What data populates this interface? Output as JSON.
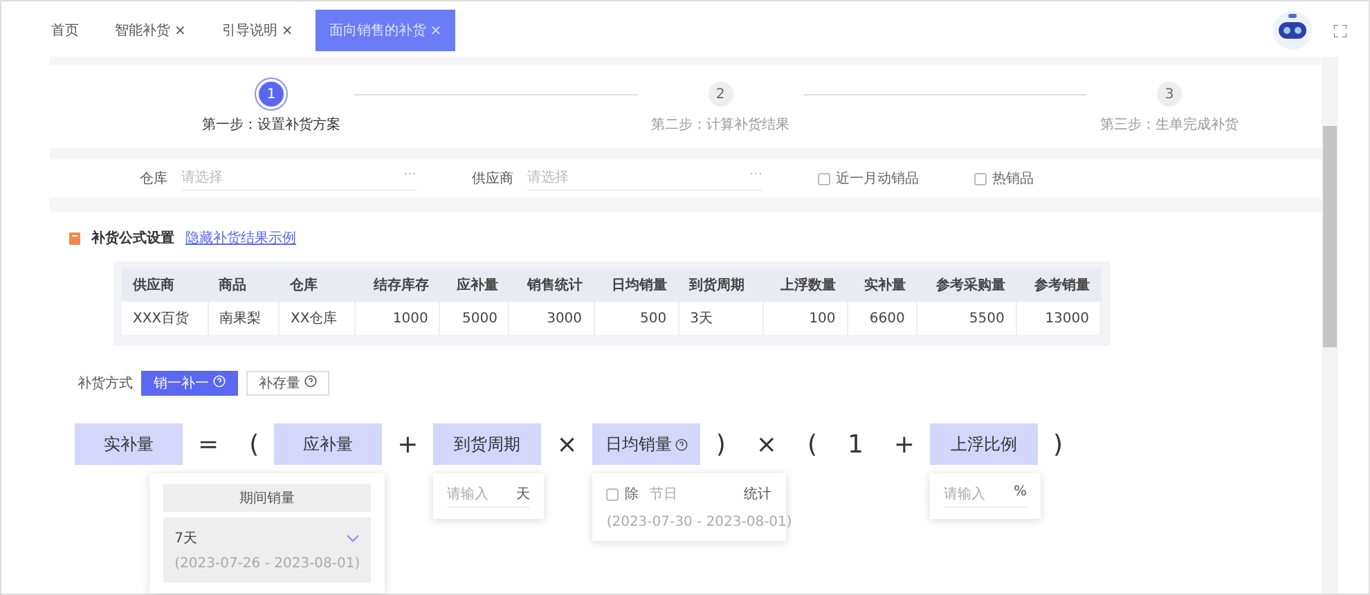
{
  "tabs": [
    {
      "label": "首页",
      "selected": false,
      "closable": false
    },
    {
      "label": "智能补货",
      "selected": false,
      "closable": true
    },
    {
      "label": "引导说明",
      "selected": false,
      "closable": true
    },
    {
      "label": "面向销售的补货",
      "selected": true,
      "closable": true
    }
  ],
  "close_glyph": "×",
  "steps": [
    {
      "number": "1",
      "label": "第一步：设置补货方案",
      "selected": true
    },
    {
      "number": "2",
      "label": "第二步：计算补货结果",
      "selected": false
    },
    {
      "number": "3",
      "label": "第三步：生单完成补货",
      "selected": false
    }
  ],
  "filters": {
    "fields": [
      {
        "label": "仓库",
        "placeholder": "请选择",
        "more": "···"
      },
      {
        "label": "供应商",
        "placeholder": "请选择",
        "more": "···"
      }
    ],
    "checkboxes": [
      {
        "label": "近一月动销品",
        "checked": false
      },
      {
        "label": "热销品",
        "checked": false
      }
    ]
  },
  "section": {
    "title": "补货公式设置",
    "link": "隐藏补货结果示例"
  },
  "table": {
    "columns": [
      "供应商",
      "商品",
      "仓库",
      "结存库存",
      "应补量",
      "销售统计",
      "日均销量",
      "到货周期",
      "上浮数量",
      "实补量",
      "参考采购量",
      "参考销量"
    ],
    "rows": [
      [
        "XXX百货",
        "南果梨",
        "XX仓库",
        "1000",
        "5000",
        "3000",
        "500",
        "3天",
        "100",
        "6600",
        "5500",
        "13000"
      ]
    ]
  },
  "method": {
    "label": "补货方式",
    "options": [
      {
        "label": "销一补一",
        "selected": true
      },
      {
        "label": "补存量",
        "selected": false
      }
    ]
  },
  "formula": [
    {
      "kind": "term",
      "label": "实补量",
      "help": false
    },
    {
      "kind": "op",
      "label": "="
    },
    {
      "kind": "op",
      "label": "("
    },
    {
      "kind": "term",
      "label": "应补量",
      "help": false,
      "popover": {
        "kind": "select",
        "title": "期间销量",
        "value": "7天",
        "range": "(2023-07-26  -  2023-08-01)"
      }
    },
    {
      "kind": "op",
      "label": "+"
    },
    {
      "kind": "term",
      "label": "到货周期",
      "help": false,
      "popover": {
        "kind": "input",
        "placeholder": "请输入",
        "unit": "天"
      }
    },
    {
      "kind": "op",
      "label": "×"
    },
    {
      "kind": "term",
      "label": "日均销量",
      "help": true,
      "popover": {
        "kind": "filter",
        "check": "除",
        "checked": false,
        "placeholder": "节日",
        "unit": "统计",
        "range": "(2023-07-30  -  2023-08-01)"
      }
    },
    {
      "kind": "op",
      "label": ")"
    },
    {
      "kind": "op",
      "label": "×"
    },
    {
      "kind": "op",
      "label": "("
    },
    {
      "kind": "op",
      "label": "1"
    },
    {
      "kind": "op",
      "label": "+"
    },
    {
      "kind": "term",
      "label": "上浮比例",
      "help": false,
      "popover": {
        "kind": "input",
        "placeholder": "请输入",
        "unit": "%"
      }
    },
    {
      "kind": "op",
      "label": ")"
    }
  ]
}
